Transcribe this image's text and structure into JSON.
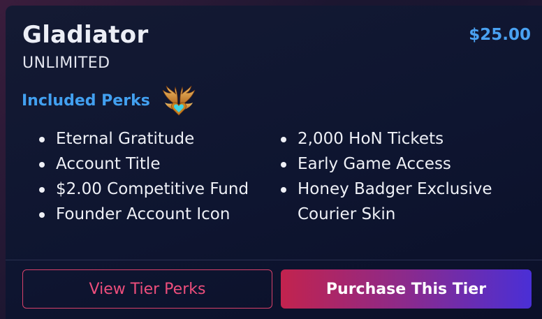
{
  "tier": {
    "name": "Gladiator",
    "duration": "UNLIMITED",
    "price": "$25.00"
  },
  "perks": {
    "heading": "Included Perks",
    "badge_icon": "winged-heart-icon",
    "left": [
      "Eternal Gratitude",
      "Account Title",
      "$2.00 Competitive Fund",
      "Founder Account Icon"
    ],
    "right": [
      "2,000 HoN Tickets",
      "Early Game Access",
      "Honey Badger Exclusive Courier Skin"
    ]
  },
  "actions": {
    "view_perks_label": "View Tier Perks",
    "purchase_label": "Purchase This Tier"
  },
  "colors": {
    "accent_blue": "#42a0f0",
    "outline_pink": "#ee4e7c",
    "gradient_start": "#c2234e",
    "gradient_end": "#4a2fd6"
  }
}
